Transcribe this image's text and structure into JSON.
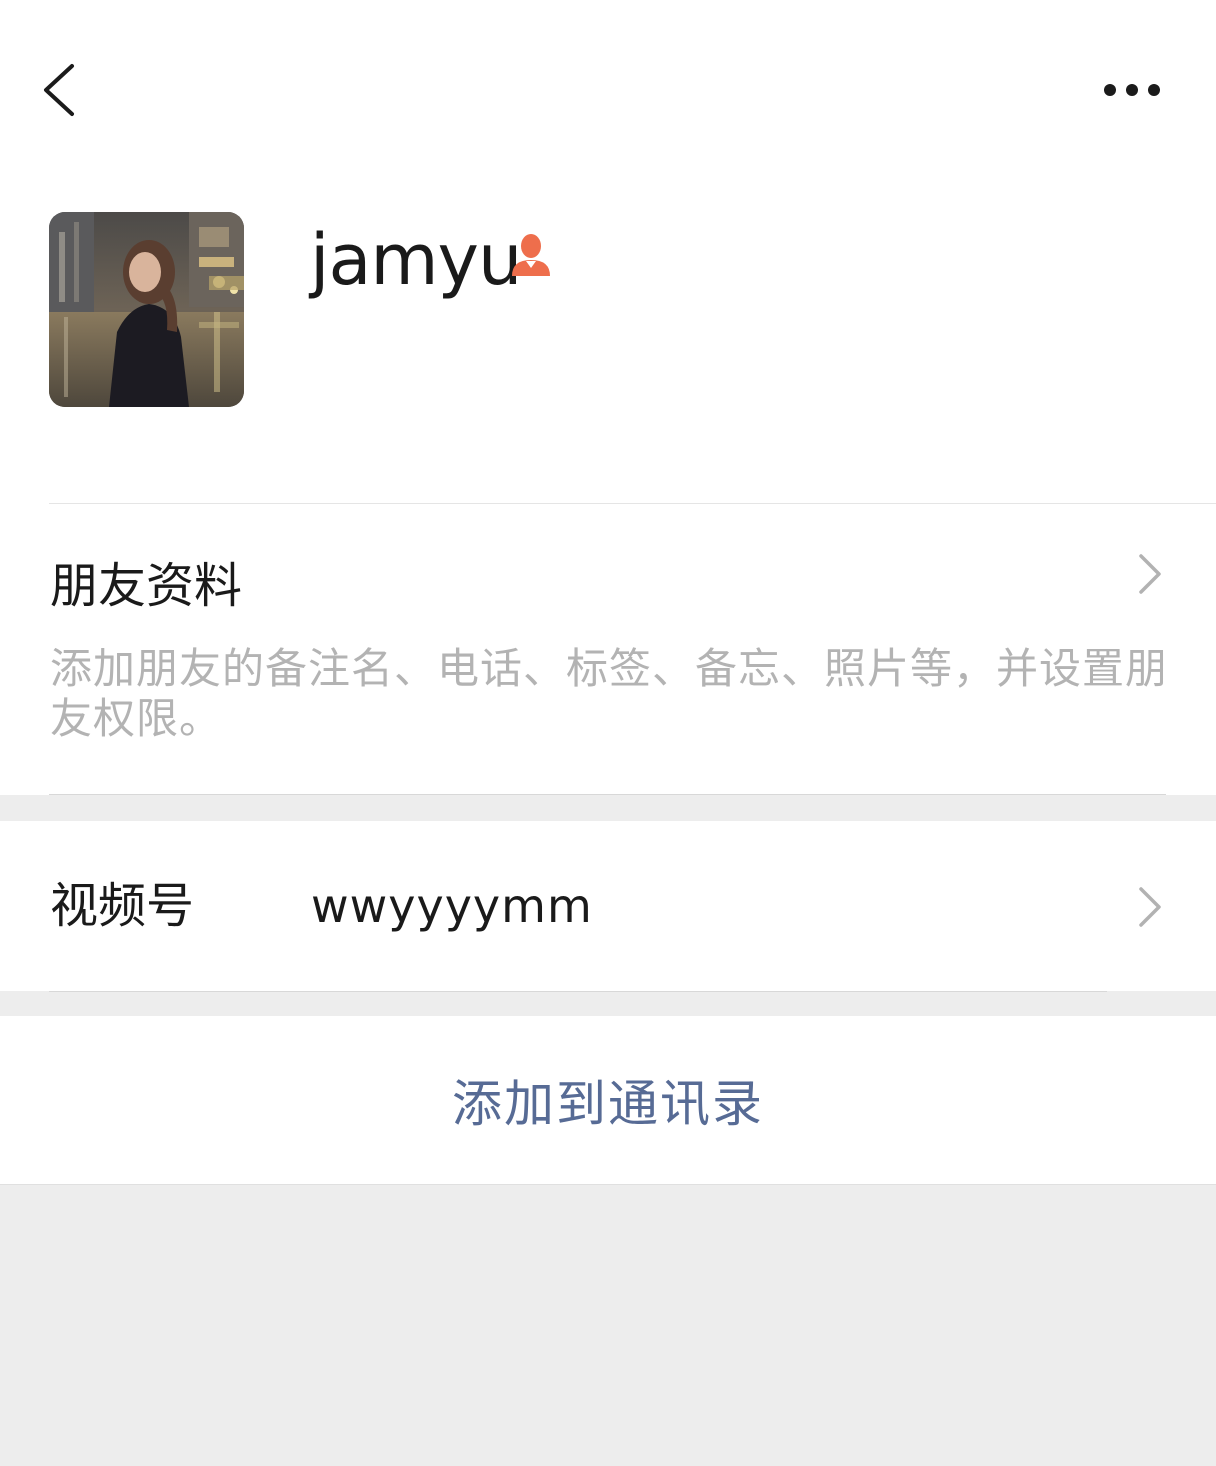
{
  "nav": {
    "back_icon": "chevron-left-icon",
    "more_icon": "more-horizontal-icon"
  },
  "profile": {
    "nickname": "jamyu",
    "gender_icon": "female-user-icon",
    "gender_color": "#ee6e4c"
  },
  "friend_info": {
    "title": "朋友资料",
    "description": "添加朋友的备注名、电话、标签、备忘、照片等，并设置朋友权限。"
  },
  "video_channel": {
    "label": "视频号",
    "value": "wwyyyymm"
  },
  "actions": {
    "add_to_contacts": "添加到通讯录",
    "link_color": "#576b95"
  }
}
